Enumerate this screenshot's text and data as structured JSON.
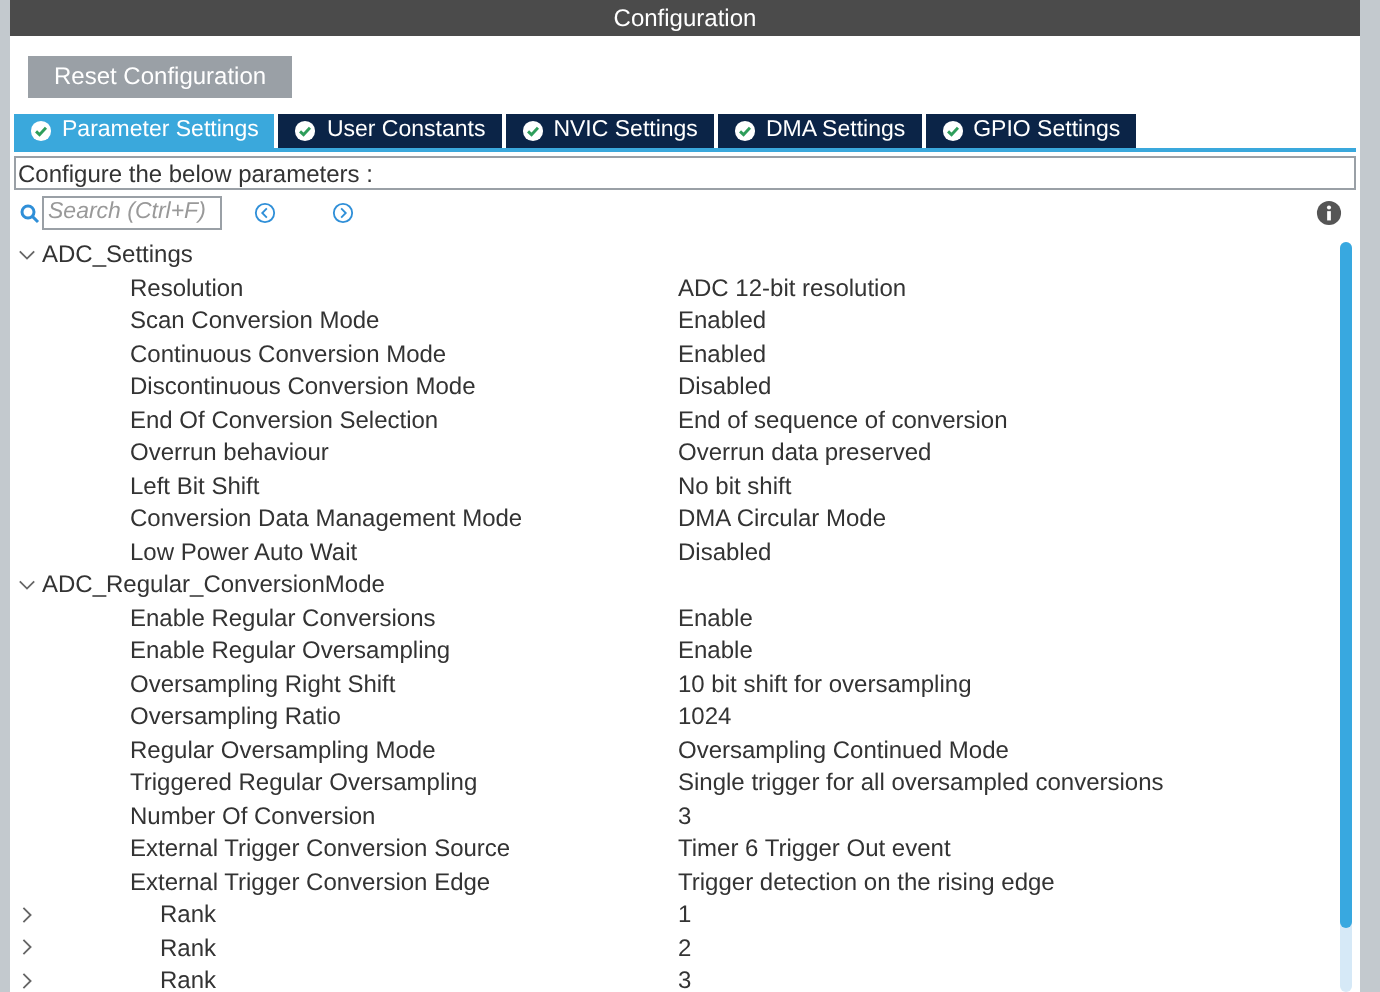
{
  "window": {
    "title": "Configuration"
  },
  "reset_button": "Reset Configuration",
  "tabs": [
    {
      "label": "Parameter Settings",
      "selected": true
    },
    {
      "label": "User Constants",
      "selected": false
    },
    {
      "label": "NVIC Settings",
      "selected": false
    },
    {
      "label": "DMA Settings",
      "selected": false
    },
    {
      "label": "GPIO Settings",
      "selected": false
    }
  ],
  "hint": "Configure the below parameters :",
  "search": {
    "placeholder": "Search (Ctrl+F)"
  },
  "tree": [
    {
      "label": "ADC_Settings",
      "expanded": true,
      "children": [
        {
          "label": "Resolution",
          "value": "ADC 12-bit resolution"
        },
        {
          "label": "Scan Conversion Mode",
          "value": "Enabled"
        },
        {
          "label": "Continuous Conversion Mode",
          "value": "Enabled"
        },
        {
          "label": "Discontinuous Conversion Mode",
          "value": "Disabled"
        },
        {
          "label": "End Of Conversion Selection",
          "value": "End of sequence of conversion"
        },
        {
          "label": "Overrun behaviour",
          "value": "Overrun data preserved"
        },
        {
          "label": "Left Bit Shift",
          "value": "No bit shift"
        },
        {
          "label": "Conversion Data Management Mode",
          "value": "DMA Circular Mode"
        },
        {
          "label": "Low Power Auto Wait",
          "value": "Disabled"
        }
      ]
    },
    {
      "label": "ADC_Regular_ConversionMode",
      "expanded": true,
      "children": [
        {
          "label": "Enable Regular Conversions",
          "value": "Enable"
        },
        {
          "label": "Enable Regular Oversampling",
          "value": "Enable"
        },
        {
          "label": "Oversampling Right Shift",
          "value": "10 bit shift for oversampling"
        },
        {
          "label": "Oversampling Ratio",
          "value": "1024"
        },
        {
          "label": "Regular Oversampling Mode",
          "value": "Oversampling Continued Mode"
        },
        {
          "label": "Triggered Regular Oversampling",
          "value": "Single trigger for all oversampled conversions"
        },
        {
          "label": "Number Of Conversion",
          "value": "3"
        },
        {
          "label": "External Trigger Conversion Source",
          "value": "Timer 6 Trigger Out event"
        },
        {
          "label": "External Trigger Conversion Edge",
          "value": "Trigger detection on the rising edge"
        },
        {
          "label": "Rank",
          "value": "1",
          "expanded": false
        },
        {
          "label": "Rank",
          "value": "2",
          "expanded": false
        },
        {
          "label": "Rank",
          "value": "3",
          "expanded": false
        }
      ]
    }
  ]
}
